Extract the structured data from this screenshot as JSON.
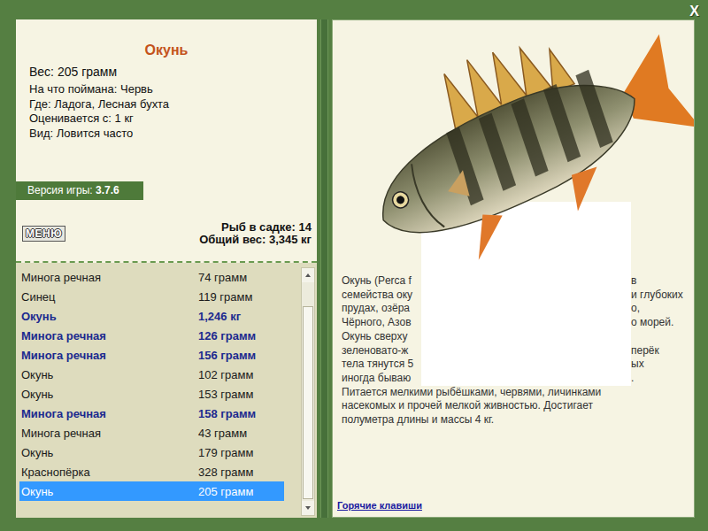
{
  "close": "X",
  "title": "Окунь",
  "details": {
    "weight": "Вес: 205 грамм",
    "lines": [
      "На что поймана: Червь",
      "Где: Ладога, Лесная бухта",
      "Оценивается с: 1 кг",
      "Вид: Ловится часто"
    ]
  },
  "version": {
    "label": "Версия игры:",
    "value": "3.7.6"
  },
  "menu_button": "МЕНЮ",
  "summary": {
    "count": "Рыб в садке: 14",
    "total": "Общий вес: 3,345 кг"
  },
  "catch_list": [
    {
      "name": "Минога речная",
      "weight": "74 грамм",
      "highlighted": false,
      "selected": false
    },
    {
      "name": "Синец",
      "weight": "119 грамм",
      "highlighted": false,
      "selected": false
    },
    {
      "name": "Окунь",
      "weight": "1,246 кг",
      "highlighted": true,
      "selected": false
    },
    {
      "name": "Минога речная",
      "weight": "126 грамм",
      "highlighted": true,
      "selected": false
    },
    {
      "name": "Минога речная",
      "weight": "156 грамм",
      "highlighted": true,
      "selected": false
    },
    {
      "name": "Окунь",
      "weight": "102 грамм",
      "highlighted": false,
      "selected": false
    },
    {
      "name": "Окунь",
      "weight": "153 грамм",
      "highlighted": false,
      "selected": false
    },
    {
      "name": "Минога речная",
      "weight": "158 грамм",
      "highlighted": true,
      "selected": false
    },
    {
      "name": "Минога речная",
      "weight": "43 грамм",
      "highlighted": false,
      "selected": false
    },
    {
      "name": "Окунь",
      "weight": "179 грамм",
      "highlighted": false,
      "selected": false
    },
    {
      "name": "Краснопёрка",
      "weight": "328 грамм",
      "highlighted": false,
      "selected": false
    },
    {
      "name": "Окунь",
      "weight": "205 грамм",
      "highlighted": false,
      "selected": true
    }
  ],
  "scrollbar": {
    "offset": 0.11,
    "size": 0.88
  },
  "description": {
    "covered_lines": [
      {
        "left": "Окунь (Perca f",
        "right": "в"
      },
      {
        "left": "семейства оку",
        "right": "и глубоких"
      },
      {
        "left": "прудах, озёра",
        "right": "о,"
      },
      {
        "left": "Чёрного, Азов",
        "right": "о морей."
      },
      {
        "left": "Окунь сверху",
        "right": ""
      },
      {
        "left": "зеленовато-ж",
        "right": "перёк"
      },
      {
        "left": "тела тянутся 5",
        "right": "ых"
      },
      {
        "left": "иногда бываю",
        "right": "."
      }
    ],
    "lines": [
      "Питается мелкими рыбёшками, червями, личинками",
      "насекомых и прочей мелкой живностью. Достигает",
      "полуметра длины и массы 4 кг."
    ]
  },
  "hotkeys": "Горячие клавиши"
}
